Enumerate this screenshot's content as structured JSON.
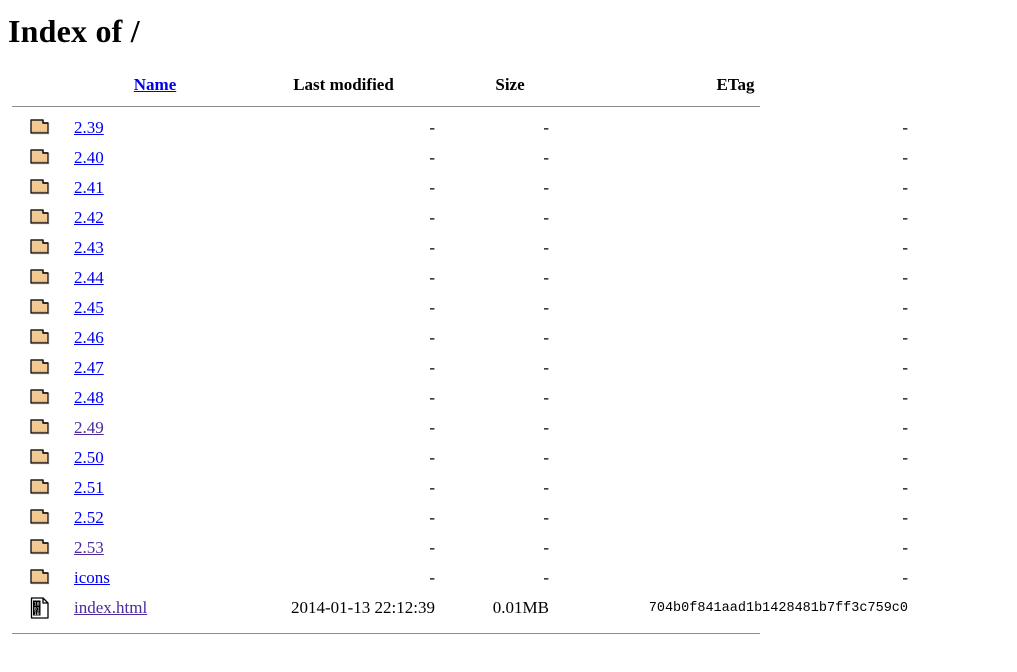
{
  "page": {
    "title": "Index of /"
  },
  "table": {
    "headers": {
      "icon": "",
      "name": "Name",
      "last_modified": "Last modified",
      "size": "Size",
      "etag": "ETag"
    },
    "rows": [
      {
        "icon": "folder-icon",
        "name": "2.39",
        "visited": false,
        "last_modified": "-",
        "size": "-",
        "etag": "-"
      },
      {
        "icon": "folder-icon",
        "name": "2.40",
        "visited": false,
        "last_modified": "-",
        "size": "-",
        "etag": "-"
      },
      {
        "icon": "folder-icon",
        "name": "2.41",
        "visited": false,
        "last_modified": "-",
        "size": "-",
        "etag": "-"
      },
      {
        "icon": "folder-icon",
        "name": "2.42",
        "visited": false,
        "last_modified": "-",
        "size": "-",
        "etag": "-"
      },
      {
        "icon": "folder-icon",
        "name": "2.43",
        "visited": false,
        "last_modified": "-",
        "size": "-",
        "etag": "-"
      },
      {
        "icon": "folder-icon",
        "name": "2.44",
        "visited": false,
        "last_modified": "-",
        "size": "-",
        "etag": "-"
      },
      {
        "icon": "folder-icon",
        "name": "2.45",
        "visited": false,
        "last_modified": "-",
        "size": "-",
        "etag": "-"
      },
      {
        "icon": "folder-icon",
        "name": "2.46",
        "visited": false,
        "last_modified": "-",
        "size": "-",
        "etag": "-"
      },
      {
        "icon": "folder-icon",
        "name": "2.47",
        "visited": false,
        "last_modified": "-",
        "size": "-",
        "etag": "-"
      },
      {
        "icon": "folder-icon",
        "name": "2.48",
        "visited": false,
        "last_modified": "-",
        "size": "-",
        "etag": "-"
      },
      {
        "icon": "folder-icon",
        "name": "2.49",
        "visited": true,
        "last_modified": "-",
        "size": "-",
        "etag": "-"
      },
      {
        "icon": "folder-icon",
        "name": "2.50",
        "visited": false,
        "last_modified": "-",
        "size": "-",
        "etag": "-"
      },
      {
        "icon": "folder-icon",
        "name": "2.51",
        "visited": false,
        "last_modified": "-",
        "size": "-",
        "etag": "-"
      },
      {
        "icon": "folder-icon",
        "name": "2.52",
        "visited": false,
        "last_modified": "-",
        "size": "-",
        "etag": "-"
      },
      {
        "icon": "folder-icon",
        "name": "2.53",
        "visited": true,
        "last_modified": "-",
        "size": "-",
        "etag": "-"
      },
      {
        "icon": "folder-icon",
        "name": "icons",
        "visited": false,
        "last_modified": "-",
        "size": "-",
        "etag": "-"
      },
      {
        "icon": "binary-file-icon",
        "name": "index.html",
        "visited": true,
        "last_modified": "2014-01-13 22:12:39",
        "size": "0.01MB",
        "etag": "704b0f841aad1b1428481b7ff3c759c0"
      }
    ]
  },
  "colors": {
    "link": "#0000EE",
    "link_visited": "#4B2A9B",
    "text": "#000000",
    "rule": "#8C8C8C",
    "folder_body": "#F2C893",
    "folder_outline": "#000000",
    "file_page": "#FFFFFF",
    "background": "#FFFFFF"
  }
}
